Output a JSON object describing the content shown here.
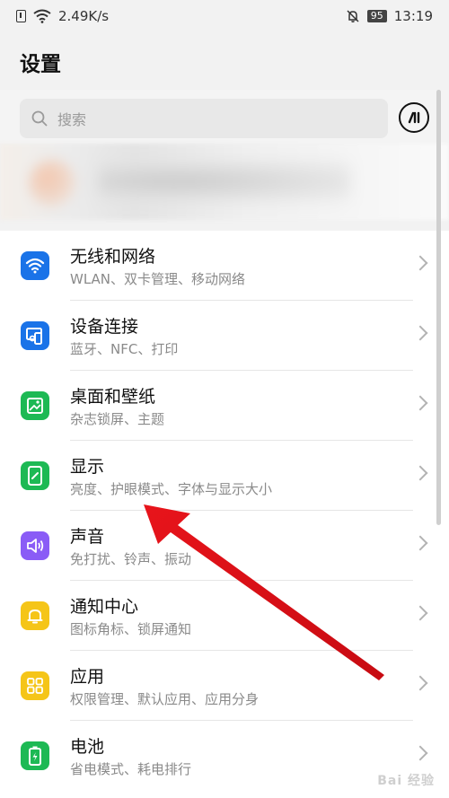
{
  "status_bar": {
    "speed": "2.49K/s",
    "battery": "95",
    "time": "13:19"
  },
  "page": {
    "title": "设置"
  },
  "search": {
    "placeholder": "搜索"
  },
  "settings": {
    "items": [
      {
        "title": "无线和网络",
        "subtitle": "WLAN、双卡管理、移动网络",
        "icon": "wifi-icon",
        "color": "#1a73e8"
      },
      {
        "title": "设备连接",
        "subtitle": "蓝牙、NFC、打印",
        "icon": "device-connection-icon",
        "color": "#1a73e8"
      },
      {
        "title": "桌面和壁纸",
        "subtitle": "杂志锁屏、主题",
        "icon": "wallpaper-icon",
        "color": "#1db954"
      },
      {
        "title": "显示",
        "subtitle": "亮度、护眼模式、字体与显示大小",
        "icon": "display-icon",
        "color": "#1db954"
      },
      {
        "title": "声音",
        "subtitle": "免打扰、铃声、振动",
        "icon": "sound-icon",
        "color": "#8a5cf6"
      },
      {
        "title": "通知中心",
        "subtitle": "图标角标、锁屏通知",
        "icon": "notification-bell-icon",
        "color": "#f5c518"
      },
      {
        "title": "应用",
        "subtitle": "权限管理、默认应用、应用分身",
        "icon": "apps-grid-icon",
        "color": "#f5c518"
      },
      {
        "title": "电池",
        "subtitle": "省电模式、耗电排行",
        "icon": "battery-icon",
        "color": "#1db954"
      }
    ]
  },
  "watermark": "Bai 经验"
}
